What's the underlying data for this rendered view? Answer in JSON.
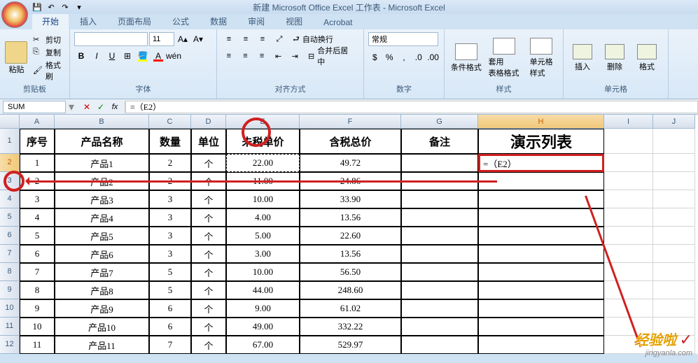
{
  "window": {
    "title": "新建 Microsoft Office Excel 工作表 - Microsoft Excel"
  },
  "ribbon_tabs": [
    "开始",
    "插入",
    "页面布局",
    "公式",
    "数据",
    "审阅",
    "视图",
    "Acrobat"
  ],
  "clipboard": {
    "paste": "粘贴",
    "cut": "剪切",
    "copy": "复制",
    "format": "格式刷",
    "group": "剪贴板"
  },
  "font": {
    "size": "11",
    "group": "字体"
  },
  "align": {
    "wrap": "自动换行",
    "merge": "合并后居中",
    "group": "对齐方式"
  },
  "number": {
    "format": "常规",
    "group": "数字"
  },
  "styles": {
    "cond": "条件格式",
    "table": "套用\n表格格式",
    "cell": "单元格\n样式",
    "group": "样式"
  },
  "cells": {
    "insert": "插入",
    "delete": "删除",
    "format": "格式",
    "group": "单元格"
  },
  "formula_bar": {
    "name_box": "SUM",
    "formula": "=（E2）"
  },
  "columns": [
    "A",
    "B",
    "C",
    "D",
    "E",
    "F",
    "G",
    "H",
    "I",
    "J"
  ],
  "headers": {
    "A": "序号",
    "B": "产品名称",
    "C": "数量",
    "D": "单位",
    "E": "未税单价",
    "F": "含税总价",
    "G": "备注",
    "H": "演示列表"
  },
  "editing_cell_value": "=（E2）",
  "rows": [
    {
      "n": 2,
      "A": "1",
      "B": "产品1",
      "C": "2",
      "D": "个",
      "E": "22.00",
      "F": "49.72"
    },
    {
      "n": 3,
      "A": "2",
      "B": "产品2",
      "C": "2",
      "D": "个",
      "E": "11.00",
      "F": "24.86"
    },
    {
      "n": 4,
      "A": "3",
      "B": "产品3",
      "C": "3",
      "D": "个",
      "E": "10.00",
      "F": "33.90"
    },
    {
      "n": 5,
      "A": "4",
      "B": "产品4",
      "C": "3",
      "D": "个",
      "E": "4.00",
      "F": "13.56"
    },
    {
      "n": 6,
      "A": "5",
      "B": "产品5",
      "C": "3",
      "D": "个",
      "E": "5.00",
      "F": "22.60"
    },
    {
      "n": 7,
      "A": "6",
      "B": "产品6",
      "C": "3",
      "D": "个",
      "E": "3.00",
      "F": "13.56"
    },
    {
      "n": 8,
      "A": "7",
      "B": "产品7",
      "C": "5",
      "D": "个",
      "E": "10.00",
      "F": "56.50"
    },
    {
      "n": 9,
      "A": "8",
      "B": "产品8",
      "C": "5",
      "D": "个",
      "E": "44.00",
      "F": "248.60"
    },
    {
      "n": 10,
      "A": "9",
      "B": "产品9",
      "C": "6",
      "D": "个",
      "E": "9.00",
      "F": "61.02"
    },
    {
      "n": 11,
      "A": "10",
      "B": "产品10",
      "C": "6",
      "D": "个",
      "E": "49.00",
      "F": "332.22"
    },
    {
      "n": 12,
      "A": "11",
      "B": "产品11",
      "C": "7",
      "D": "个",
      "E": "67.00",
      "F": "529.97"
    }
  ],
  "watermark": {
    "line1": "经验啦",
    "line2": "jingyanla.com"
  }
}
